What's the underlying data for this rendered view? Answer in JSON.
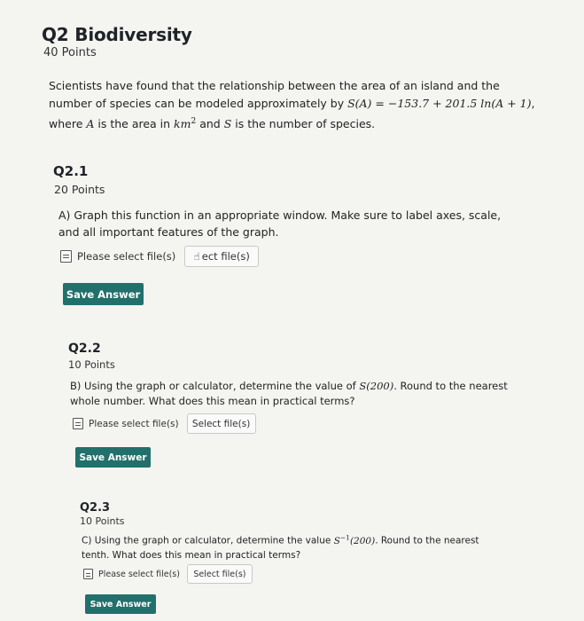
{
  "question": {
    "title": "Q2 Biodiversity",
    "points": "40 Points",
    "prompt": {
      "p1": "Scientists have found that the relationship between the area of an island and the number of species can be modeled approximately by ",
      "formula": "S(A) = −153.7 + 201.5 ln(A + 1)",
      "p2": ", where ",
      "varA": "A",
      "p3": " is the area in ",
      "unit_base": "km",
      "unit_exp": "2",
      "p4": " and ",
      "varS": "S",
      "p5": " is the number of species."
    }
  },
  "subquestions": [
    {
      "title": "Q2.1",
      "points": "20 Points",
      "text": "A) Graph this function in an appropriate window. Make sure to label axes, scale, and all important features of the graph.",
      "file_label": "Please select file(s)",
      "select_label": "ect file(s)",
      "save_label": "Save Answer"
    },
    {
      "title": "Q2.2",
      "points": "10 Points",
      "text_a": "B) Using the graph or calculator, determine the value of ",
      "expr": "S(200)",
      "text_b": ". Round to the nearest whole number. What does this mean in practical terms?",
      "file_label": "Please select file(s)",
      "select_label": "Select file(s)",
      "save_label": "Save Answer"
    },
    {
      "title": "Q2.3",
      "points": "10 Points",
      "text_a": "C) Using the graph or calculator, determine the value ",
      "expr_base": "S",
      "expr_exp": "−1",
      "expr_arg": "(200)",
      "text_b": ". Round to the nearest tenth. What does this mean in practical terms?",
      "file_label": "Please select file(s)",
      "select_label": "Select file(s)",
      "save_label": "Save Answer"
    }
  ],
  "colors": {
    "save_button": "#22706b",
    "background": "#f4f4f1"
  },
  "icons": {
    "file": "document-icon",
    "cursor": "hand-pointer-icon"
  }
}
